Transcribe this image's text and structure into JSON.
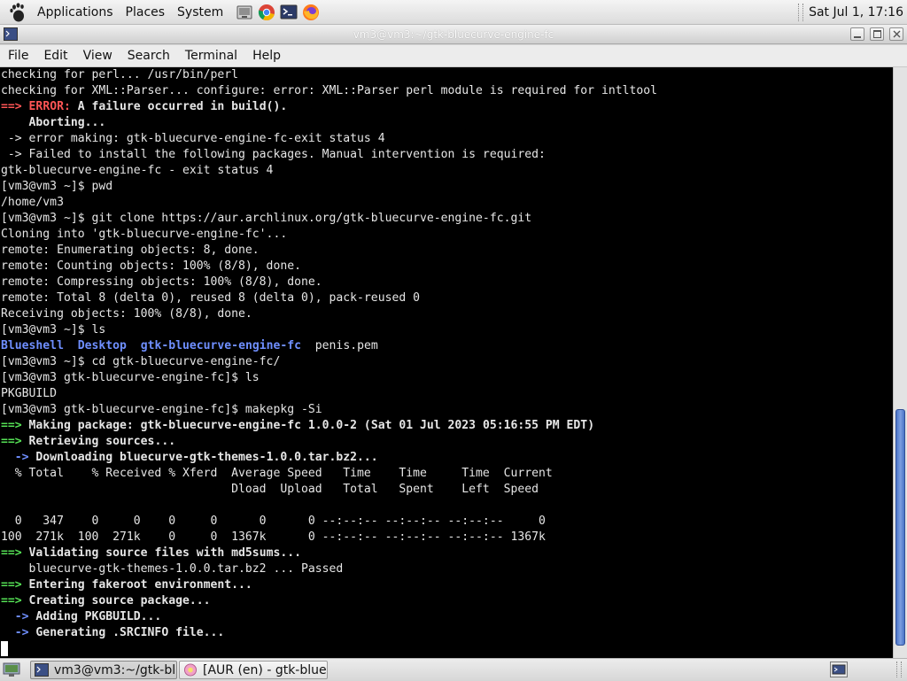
{
  "top_panel": {
    "menus": [
      "Applications",
      "Places",
      "System"
    ],
    "launchers": [
      "file-manager-icon",
      "chrome-icon",
      "terminal-icon",
      "firefox-icon"
    ],
    "clock": "Sat Jul  1, 17:16"
  },
  "window": {
    "title": "vm3@vm3:~/gtk-bluecurve-engine-fc",
    "menus": [
      "File",
      "Edit",
      "View",
      "Search",
      "Terminal",
      "Help"
    ]
  },
  "terminal": {
    "lines": [
      [
        {
          "t": "checking for perl... /usr/bin/perl"
        }
      ],
      [
        {
          "t": "checking for XML::Parser... configure: error: XML::Parser perl module is required for intltool"
        }
      ],
      [
        {
          "t": "==> ",
          "c": "red"
        },
        {
          "t": "ERROR:",
          "c": "red"
        },
        {
          "t": " A failure occurred in build().",
          "c": "b"
        }
      ],
      [
        {
          "t": "    Aborting...",
          "c": "b"
        }
      ],
      [
        {
          "t": " -> error making: gtk-bluecurve-engine-fc-exit status 4"
        }
      ],
      [
        {
          "t": " -> Failed to install the following packages. Manual intervention is required:"
        }
      ],
      [
        {
          "t": "gtk-bluecurve-engine-fc - exit status 4"
        }
      ],
      [
        {
          "t": "[vm3@vm3 ~]$ pwd"
        }
      ],
      [
        {
          "t": "/home/vm3"
        }
      ],
      [
        {
          "t": "[vm3@vm3 ~]$ git clone https://aur.archlinux.org/gtk-bluecurve-engine-fc.git"
        }
      ],
      [
        {
          "t": "Cloning into 'gtk-bluecurve-engine-fc'..."
        }
      ],
      [
        {
          "t": "remote: Enumerating objects: 8, done."
        }
      ],
      [
        {
          "t": "remote: Counting objects: 100% (8/8), done."
        }
      ],
      [
        {
          "t": "remote: Compressing objects: 100% (8/8), done."
        }
      ],
      [
        {
          "t": "remote: Total 8 (delta 0), reused 8 (delta 0), pack-reused 0"
        }
      ],
      [
        {
          "t": "Receiving objects: 100% (8/8), done."
        }
      ],
      [
        {
          "t": "[vm3@vm3 ~]$ ls"
        }
      ],
      [
        {
          "t": "Blueshell",
          "c": "blue"
        },
        {
          "t": "  "
        },
        {
          "t": "Desktop",
          "c": "blue"
        },
        {
          "t": "  "
        },
        {
          "t": "gtk-bluecurve-engine-fc",
          "c": "blue"
        },
        {
          "t": "  penis.pem"
        }
      ],
      [
        {
          "t": "[vm3@vm3 ~]$ cd gtk-bluecurve-engine-fc/"
        }
      ],
      [
        {
          "t": "[vm3@vm3 gtk-bluecurve-engine-fc]$ ls"
        }
      ],
      [
        {
          "t": "PKGBUILD"
        }
      ],
      [
        {
          "t": "[vm3@vm3 gtk-bluecurve-engine-fc]$ makepkg -Si"
        }
      ],
      [
        {
          "t": "==> ",
          "c": "green"
        },
        {
          "t": "Making package: gtk-bluecurve-engine-fc 1.0.0-2 (Sat 01 Jul 2023 05:16:55 PM EDT)",
          "c": "b"
        }
      ],
      [
        {
          "t": "==> ",
          "c": "green"
        },
        {
          "t": "Retrieving sources...",
          "c": "b"
        }
      ],
      [
        {
          "t": "  -> ",
          "c": "blue"
        },
        {
          "t": "Downloading bluecurve-gtk-themes-1.0.0.tar.bz2...",
          "c": "b"
        }
      ],
      [
        {
          "t": "  % Total    % Received % Xferd  Average Speed   Time    Time     Time  Current"
        }
      ],
      [
        {
          "t": "                                 Dload  Upload   Total   Spent    Left  Speed"
        }
      ],
      [
        {
          "t": ""
        }
      ],
      [
        {
          "t": "  0   347    0     0    0     0      0      0 --:--:-- --:--:-- --:--:--     0"
        }
      ],
      [
        {
          "t": "100  271k  100  271k    0     0  1367k      0 --:--:-- --:--:-- --:--:-- 1367k"
        }
      ],
      [
        {
          "t": "==> ",
          "c": "green"
        },
        {
          "t": "Validating source files with md5sums...",
          "c": "b"
        }
      ],
      [
        {
          "t": "    bluecurve-gtk-themes-1.0.0.tar.bz2 ... Passed"
        }
      ],
      [
        {
          "t": "==> ",
          "c": "green"
        },
        {
          "t": "Entering fakeroot environment...",
          "c": "b"
        }
      ],
      [
        {
          "t": "==> ",
          "c": "green"
        },
        {
          "t": "Creating source package...",
          "c": "b"
        }
      ],
      [
        {
          "t": "  -> ",
          "c": "blue"
        },
        {
          "t": "Adding PKGBUILD...",
          "c": "b"
        }
      ],
      [
        {
          "t": "  -> ",
          "c": "blue"
        },
        {
          "t": "Generating .SRCINFO file...",
          "c": "b"
        }
      ],
      [
        {
          "t": "",
          "cursor": true
        }
      ]
    ],
    "colors": {
      "background": "#000000",
      "text": "#e6e6e6",
      "green": "#55e055",
      "red": "#ff5555",
      "blue": "#6f8fff"
    }
  },
  "scrollbar": {
    "thumb_fraction": 0.4,
    "position": "bottom"
  },
  "taskbar": {
    "tasks": [
      {
        "label": "vm3@vm3:~/gtk-bl...",
        "icon": "terminal-icon",
        "active": true
      },
      {
        "label": "[AUR (en) - gtk-blue...",
        "icon": "browser-icon",
        "active": false
      }
    ]
  }
}
